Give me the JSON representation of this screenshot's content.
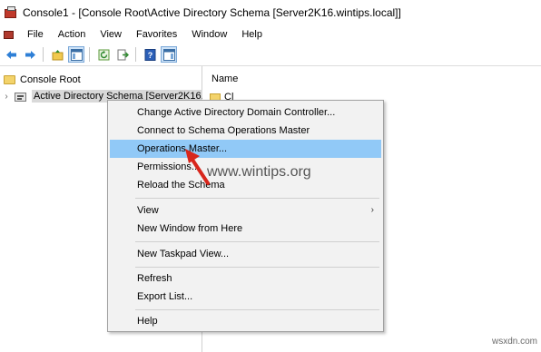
{
  "window": {
    "title": "Console1 - [Console Root\\Active Directory Schema [Server2K16.wintips.local]]"
  },
  "menubar": {
    "items": [
      "File",
      "Action",
      "View",
      "Favorites",
      "Window",
      "Help"
    ]
  },
  "toolbar": {
    "buttons": [
      "back-icon",
      "forward-icon",
      "up-folder-icon",
      "show-hide-tree-icon",
      "refresh-icon",
      "export-icon",
      "help-icon",
      "action-pane-icon"
    ]
  },
  "tree": {
    "root": "Console Root",
    "child": "Active Directory Schema [Server2K16."
  },
  "list": {
    "column_name": "Name",
    "first_item": "Cl"
  },
  "context_menu": {
    "items": [
      "Change Active Directory Domain Controller...",
      "Connect to Schema Operations Master",
      "Operations Master...",
      "Permissions...",
      "Reload the Schema",
      "View",
      "New Window from Here",
      "New Taskpad View...",
      "Refresh",
      "Export List...",
      "Help"
    ],
    "highlighted": "Operations Master..."
  },
  "watermark": "www.wintips.org",
  "site_logo": "wsxdn.com",
  "colors": {
    "highlight": "#91c9f7",
    "arrow": "#d8261c"
  }
}
